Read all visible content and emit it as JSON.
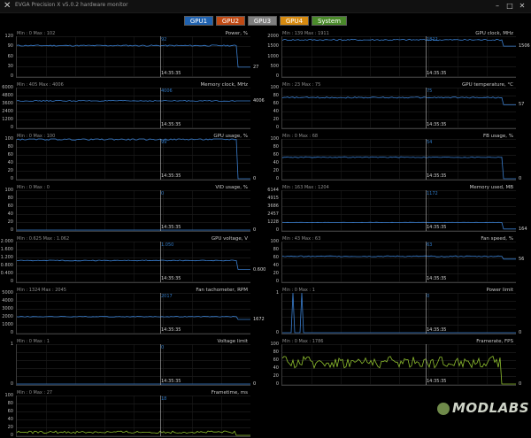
{
  "window": {
    "title": "EVGA Precision X v5.0.2 hardware monitor"
  },
  "tabs": [
    {
      "label": "GPU1",
      "color": "#1f62b0"
    },
    {
      "label": "GPU2",
      "color": "#c14a14"
    },
    {
      "label": "GPU3",
      "color": "#7f7f7f"
    },
    {
      "label": "GPU4",
      "color": "#d68a10"
    },
    {
      "label": "System",
      "color": "#4a8a2a"
    }
  ],
  "colors": {
    "line": "#3a7fd0",
    "fps": "#8fbf2f",
    "grid": "#3a3a3a"
  },
  "cursor_time": "14:35:35",
  "watermark": "MODLABS",
  "panels": [
    {
      "col": 0,
      "row": 0,
      "name": "Power, %",
      "stats": "Min : 0   Max : 102",
      "ticks": [
        "120",
        "90",
        "60",
        "30",
        "0"
      ],
      "max": 120,
      "cursor_value": "92",
      "current": "27"
    },
    {
      "col": 1,
      "row": 0,
      "name": "GPU clock, MHz",
      "stats": "Min : 139   Max : 1911",
      "ticks": [
        "2000",
        "1500",
        "1000",
        "500",
        "0"
      ],
      "max": 2000,
      "cursor_value": "1822",
      "current": "1506"
    },
    {
      "col": 0,
      "row": 1,
      "name": "Memory clock, MHz",
      "stats": "Min : 405   Max : 4006",
      "ticks": [
        "6000",
        "4800",
        "3600",
        "2400",
        "1200",
        "0"
      ],
      "max": 6000,
      "cursor_value": "4006",
      "current": "4006"
    },
    {
      "col": 1,
      "row": 1,
      "name": "GPU temperature, °C",
      "stats": "Min : 23   Max : 75",
      "ticks": [
        "100",
        "80",
        "60",
        "40",
        "20",
        "0"
      ],
      "max": 100,
      "cursor_value": "75",
      "current": "57"
    },
    {
      "col": 0,
      "row": 2,
      "name": "GPU usage, %",
      "stats": "Min : 0   Max : 100",
      "ticks": [
        "100",
        "80",
        "60",
        "40",
        "20",
        "0"
      ],
      "max": 100,
      "cursor_value": "99",
      "current": "0"
    },
    {
      "col": 1,
      "row": 2,
      "name": "FB usage, %",
      "stats": "Min : 0   Max : 68",
      "ticks": [
        "100",
        "80",
        "60",
        "40",
        "20",
        "0"
      ],
      "max": 100,
      "cursor_value": "54",
      "current": "0"
    },
    {
      "col": 0,
      "row": 3,
      "name": "VID usage, %",
      "stats": "Min : 0   Max : 0",
      "ticks": [
        "100",
        "80",
        "60",
        "40",
        "20",
        "0"
      ],
      "max": 100,
      "cursor_value": "0",
      "current": "0"
    },
    {
      "col": 1,
      "row": 3,
      "name": "Memory used, MB",
      "stats": "Min : 163   Max : 1204",
      "ticks": [
        "6144",
        "4915",
        "3686",
        "2457",
        "1228",
        "0"
      ],
      "max": 6144,
      "cursor_value": "1172",
      "current": "164"
    },
    {
      "col": 0,
      "row": 4,
      "name": "GPU voltage, V",
      "stats": "Min : 0.625   Max : 1.062",
      "ticks": [
        "2.000",
        "1.600",
        "1.200",
        "0.800",
        "0.400",
        "0"
      ],
      "max": 2,
      "cursor_value": "1.050",
      "current": "0.600"
    },
    {
      "col": 1,
      "row": 4,
      "name": "Fan speed, %",
      "stats": "Min : 43   Max : 63",
      "ticks": [
        "100",
        "80",
        "60",
        "40",
        "20",
        "0"
      ],
      "max": 100,
      "cursor_value": "63",
      "current": "56"
    },
    {
      "col": 0,
      "row": 5,
      "name": "Fan tachometer, RPM",
      "stats": "Min : 1324   Max : 2045",
      "ticks": [
        "5000",
        "4000",
        "3000",
        "2000",
        "1000",
        "0"
      ],
      "max": 5000,
      "cursor_value": "2017",
      "current": "1672"
    },
    {
      "col": 1,
      "row": 5,
      "name": "Power limit",
      "stats": "Min : 0   Max : 1",
      "ticks": [
        "1",
        "",
        "",
        "",
        "",
        "0"
      ],
      "max": 1,
      "cursor_value": "0",
      "current": "0"
    },
    {
      "col": 0,
      "row": 6,
      "name": "Voltage limit",
      "stats": "Min : 0   Max : 1",
      "ticks": [
        "1",
        "",
        "",
        "",
        "",
        "0"
      ],
      "max": 1,
      "cursor_value": "0",
      "current": "0"
    },
    {
      "col": 1,
      "row": 6,
      "name": "Framerate, FPS",
      "stats": "Min : 0   Max : 1786",
      "ticks": [
        "100",
        "80",
        "60",
        "40",
        "20",
        "0"
      ],
      "max": 100,
      "cursor_value": "",
      "current": "0"
    },
    {
      "col": 0,
      "row": 7,
      "name": "Frametime, ms",
      "stats": "Min : 0   Max : 27",
      "ticks": [
        "100",
        "80",
        "60",
        "40",
        "20",
        "0"
      ],
      "max": 100,
      "cursor_value": "18",
      "current": ""
    }
  ]
}
